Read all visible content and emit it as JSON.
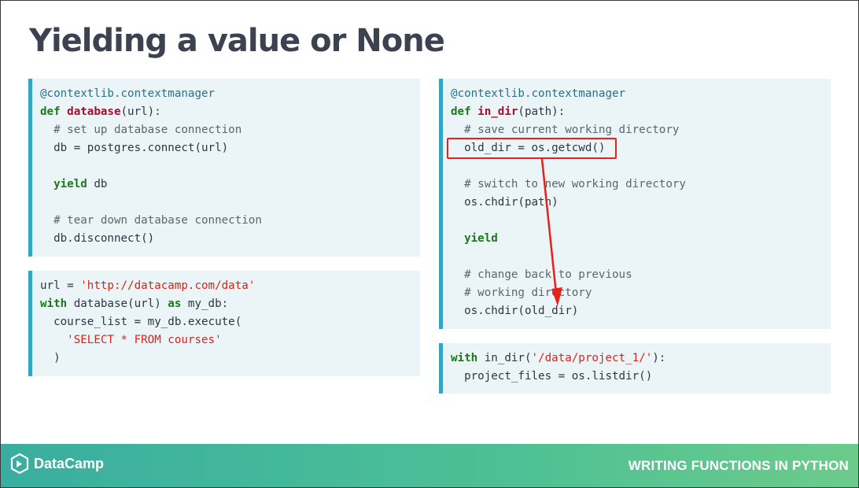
{
  "slide": {
    "title": "Yielding a value or None"
  },
  "code": {
    "box1": {
      "l1": "@contextlib.contextmanager",
      "l2_kw": "def",
      "l2_fn": "database",
      "l2_rest": "(url):",
      "l3": "  # set up database connection",
      "l4": "  db = postgres.connect(url)",
      "l6_kw": "yield",
      "l6_rest": " db",
      "l8": "  # tear down database connection",
      "l9": "  db.disconnect()"
    },
    "box2": {
      "l1_a": "url = ",
      "l1_str": "'http://datacamp.com/data'",
      "l2_kw": "with",
      "l2_mid": " database(url) ",
      "l2_kw2": "as",
      "l2_rest": " my_db:",
      "l3": "  course_list = my_db.execute(",
      "l4_str": "'SELECT * FROM courses'",
      "l5": "  )"
    },
    "box3": {
      "l1": "@contextlib.contextmanager",
      "l2_kw": "def",
      "l2_fn": "in_dir",
      "l2_rest": "(path):",
      "l3": "  # save current working directory",
      "l4": "  old_dir = os.getcwd()",
      "l6": "  # switch to new working directory",
      "l7": "  os.chdir(path)",
      "l9_kw": "yield",
      "l11": "  # change back to previous",
      "l12": "  # working directory",
      "l13": "  os.chdir(old_dir)"
    },
    "box4": {
      "l1_kw": "with",
      "l1_mid": " in_dir(",
      "l1_str": "'/data/project_1/'",
      "l1_rest": "):",
      "l2": "  project_files = os.listdir()"
    }
  },
  "footer": {
    "brand": "DataCamp",
    "course": "WRITING FUNCTIONS IN PYTHON"
  },
  "colors": {
    "accent_border": "#33a6c5",
    "code_bg": "#ebf4f7",
    "annotation_red": "#e8201a",
    "footer_green": "#4ec095"
  },
  "icons": {
    "logo": "datacamp-logo-icon"
  }
}
